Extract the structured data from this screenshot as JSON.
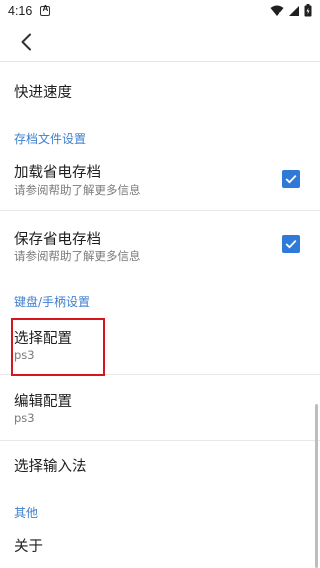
{
  "status_bar": {
    "time": "4:16"
  },
  "settings": {
    "speed_item": {
      "title": "快进速度"
    },
    "save_category": "存档文件设置",
    "load_power_save": {
      "title": "加载省电存档",
      "summary": "请参阅帮助了解更多信息",
      "checked": true
    },
    "save_power_save": {
      "title": "保存省电存档",
      "summary": "请参阅帮助了解更多信息",
      "checked": true
    },
    "keyboard_category": "键盘/手柄设置",
    "select_config": {
      "title": "选择配置",
      "summary": "ps3"
    },
    "edit_config": {
      "title": "编辑配置",
      "summary": "ps3"
    },
    "input_method": {
      "title": "选择输入法"
    },
    "other_category": "其他",
    "about": {
      "title": "关于"
    }
  },
  "colors": {
    "accent": "#3f7fcf",
    "checkbox": "#2f7ad8",
    "highlight": "#d6161c"
  }
}
